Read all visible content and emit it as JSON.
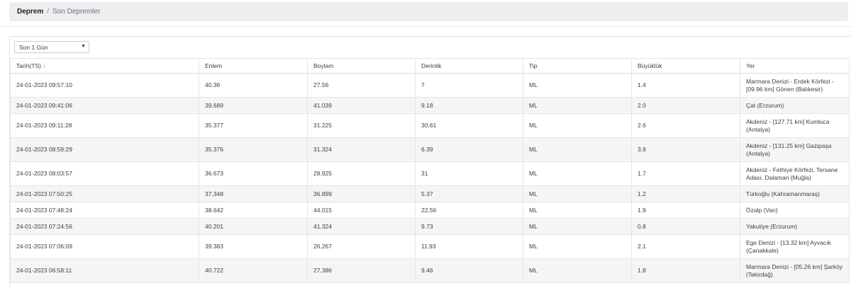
{
  "breadcrumb": {
    "main": "Deprem",
    "separator": "/",
    "current": "Son Depremler"
  },
  "filter": {
    "selected": "Son 1 Gün",
    "caret_icon": "triangle-down-icon"
  },
  "table": {
    "headers": [
      "Tarih(TS)",
      "Enlem",
      "Boylam",
      "Derinlik",
      "Tip",
      "Büyüklük",
      "Yer"
    ],
    "sort_arrow": "↓",
    "rows": [
      {
        "date": "24-01-2023 09:57:10",
        "lat": "40.36",
        "lon": "27.56",
        "depth": "7",
        "type": "ML",
        "mag": "1.4",
        "place": "Marmara Denizi - Erdek Körfezi - [09.96 km] Gönen (Balıkesir)"
      },
      {
        "date": "24-01-2023 09:41:06",
        "lat": "39.689",
        "lon": "41.039",
        "depth": "9.18",
        "type": "ML",
        "mag": "2.0",
        "place": "Çat (Erzurum)"
      },
      {
        "date": "24-01-2023 09:11:28",
        "lat": "35.377",
        "lon": "31.225",
        "depth": "30.61",
        "type": "ML",
        "mag": "2.6",
        "place": "Akdeniz - [127.71 km] Kumluca (Antalya)"
      },
      {
        "date": "24-01-2023 08:59:29",
        "lat": "35.376",
        "lon": "31.324",
        "depth": "6.39",
        "type": "ML",
        "mag": "3.9",
        "place": "Akdeniz - [131.25 km] Gazipaşa (Antalya)"
      },
      {
        "date": "24-01-2023 08:03:57",
        "lat": "36.673",
        "lon": "28.925",
        "depth": "31",
        "type": "ML",
        "mag": "1.7",
        "place": "Akdeniz - Fethiye Körfezi, Tersane Adası, Dalaman (Muğla)"
      },
      {
        "date": "24-01-2023 07:50:25",
        "lat": "37.348",
        "lon": "36.899",
        "depth": "5.37",
        "type": "ML",
        "mag": "1.2",
        "place": "Türkoğlu (Kahramanmaraş)"
      },
      {
        "date": "24-01-2023 07:48:24",
        "lat": "38.642",
        "lon": "44.015",
        "depth": "22.56",
        "type": "ML",
        "mag": "1.9",
        "place": "Özalp (Van)"
      },
      {
        "date": "24-01-2023 07:24:56",
        "lat": "40.201",
        "lon": "41.324",
        "depth": "9.73",
        "type": "ML",
        "mag": "0.8",
        "place": "Yakutiye (Erzurum)"
      },
      {
        "date": "24-01-2023 07:06:09",
        "lat": "39.383",
        "lon": "26.267",
        "depth": "11.93",
        "type": "ML",
        "mag": "2.1",
        "place": "Ege Denizi - [13.32 km] Ayvacık (Çanakkale)"
      },
      {
        "date": "24-01-2023 06:58:11",
        "lat": "40.722",
        "lon": "27.386",
        "depth": "9.46",
        "type": "ML",
        "mag": "1.8",
        "place": "Marmara Denizi - [05.26 km] Şarköy (Tekirdağ)"
      }
    ]
  }
}
